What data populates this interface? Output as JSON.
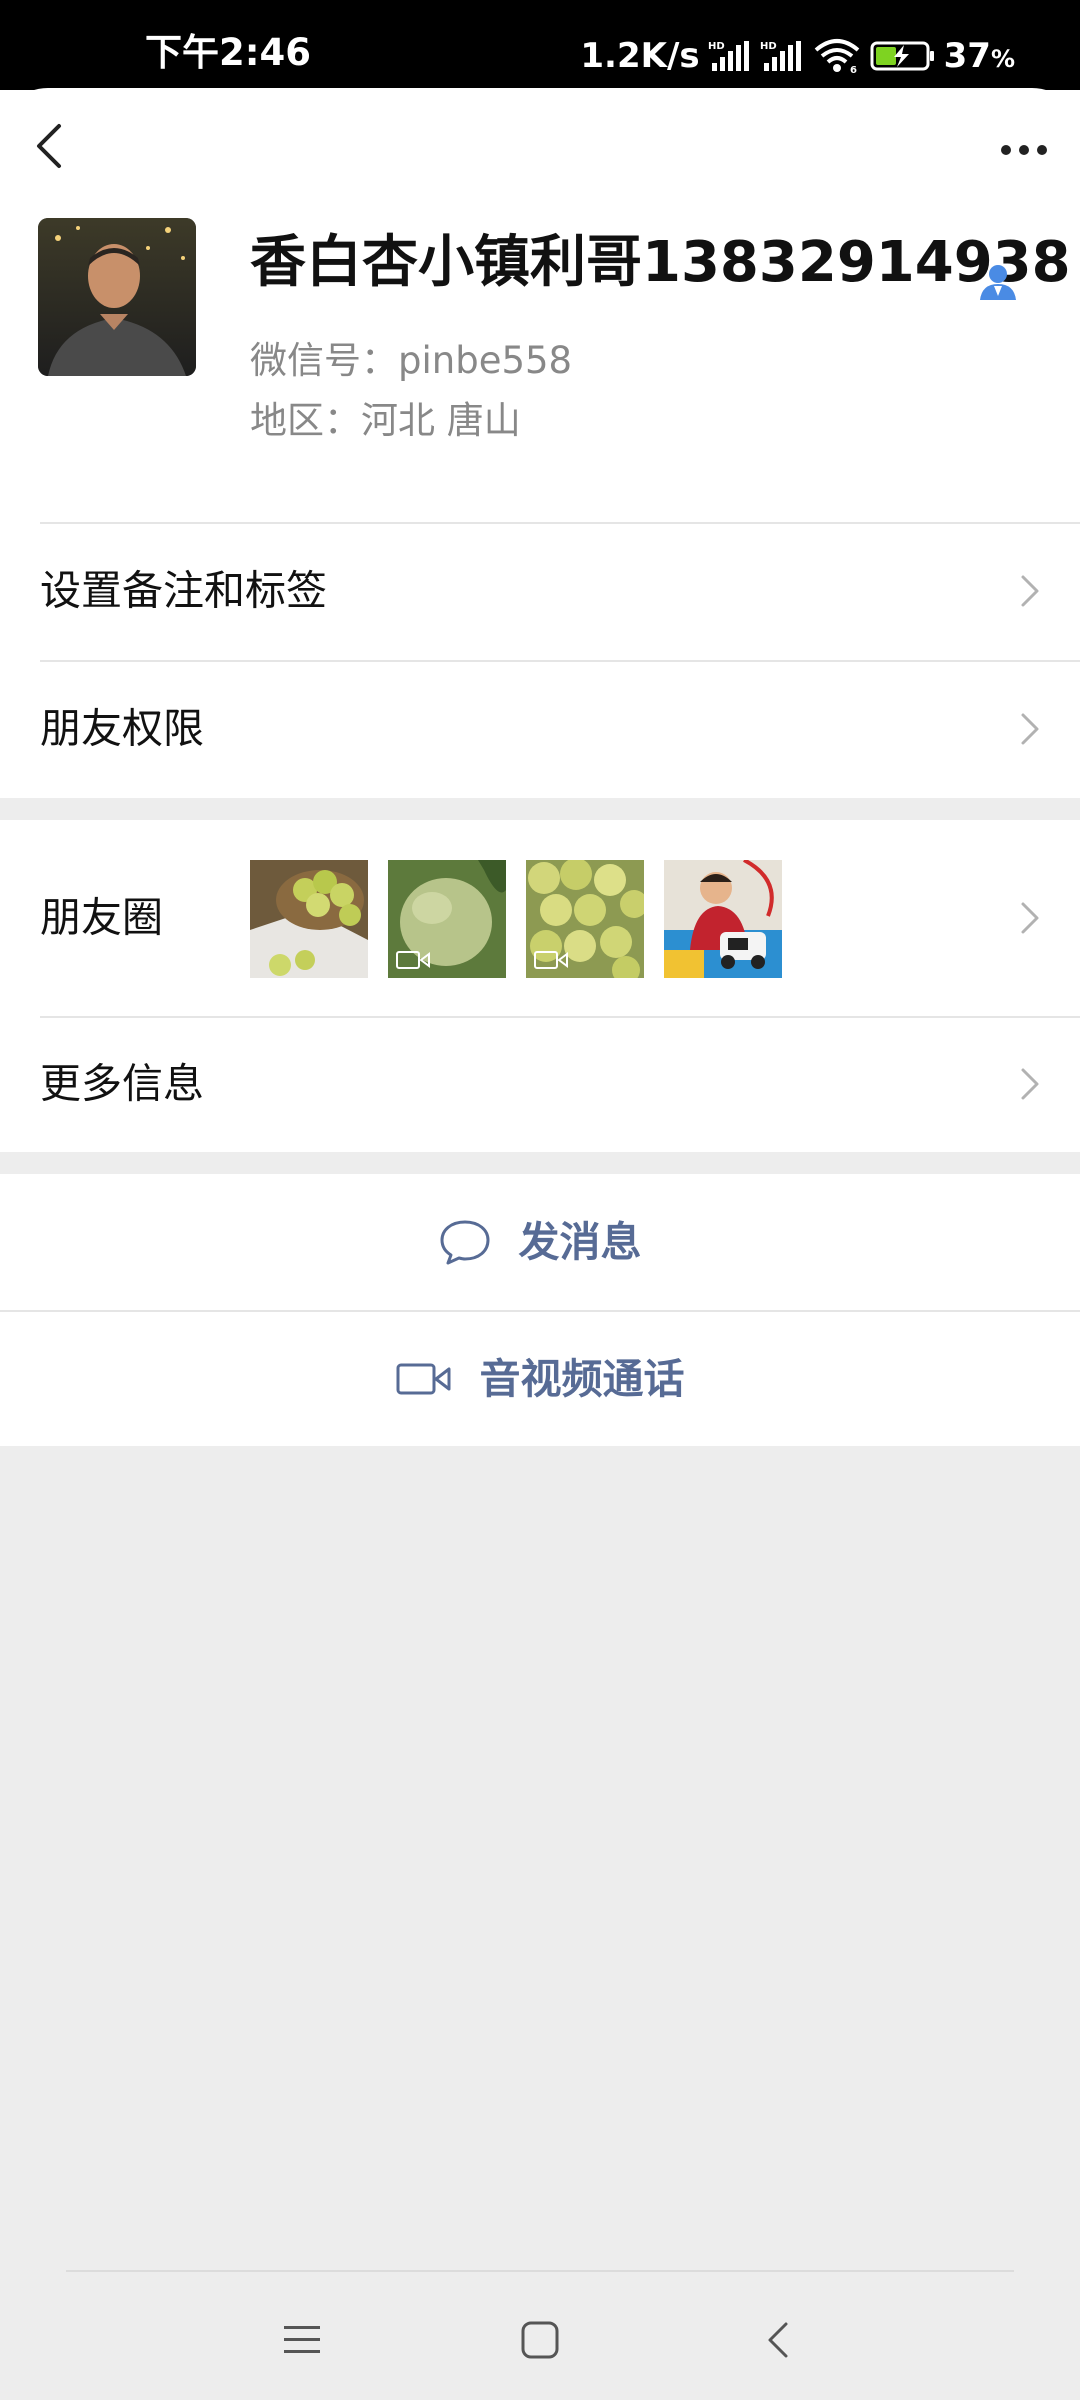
{
  "status_bar": {
    "time": "下午2:46",
    "network_speed": "1.2K/s",
    "battery_level": "37",
    "battery_unit": "%"
  },
  "profile": {
    "name": "香白杏小镇利哥13832914938",
    "wechat_id": "微信号：pinbe558",
    "region": "地区：河北  唐山"
  },
  "settings": {
    "remark_label": "设置备注和标签",
    "permission_label": "朋友权限"
  },
  "moments": {
    "label": "朋友圈",
    "photos": [
      {
        "icon": "apricot-basket-photo",
        "video": false
      },
      {
        "icon": "apricot-closeup-photo",
        "video": true
      },
      {
        "icon": "apricot-pile-photo",
        "video": true
      },
      {
        "icon": "child-toy-car-photo",
        "video": false
      }
    ]
  },
  "more_info": {
    "label": "更多信息"
  },
  "actions": {
    "message_label": "发消息",
    "call_label": "音视频通话"
  },
  "colors": {
    "link_blue": "#576b95",
    "background_gray": "#ededed",
    "contact_icon_blue": "#4a8be4"
  }
}
